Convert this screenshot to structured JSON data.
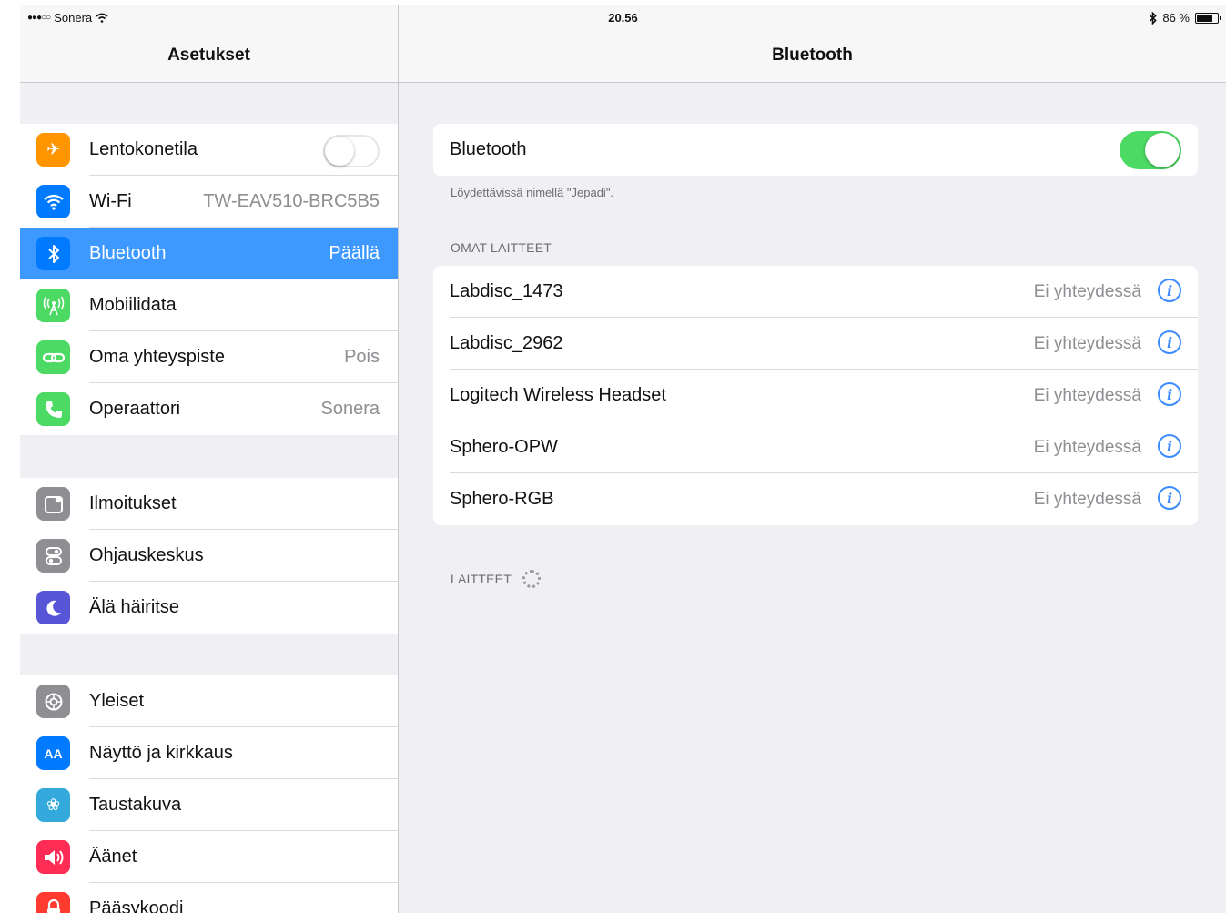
{
  "status_bar": {
    "carrier": "Sonera",
    "time": "20.56",
    "battery": "86 %",
    "battery_level": 0.86
  },
  "master": {
    "title": "Asetukset",
    "group1": [
      {
        "label": "Lentokonetila",
        "icon": "airplane-icon",
        "color": "#ff9500",
        "toggle": false
      },
      {
        "label": "Wi-Fi",
        "icon": "wifi-icon",
        "color": "#007aff",
        "value": "TW-EAV510-BRC5B5"
      },
      {
        "label": "Bluetooth",
        "icon": "bluetooth-icon",
        "color": "#007aff",
        "value": "Päällä",
        "selected": true
      },
      {
        "label": "Mobiilidata",
        "icon": "antenna-icon",
        "color": "#4cd964"
      },
      {
        "label": "Oma yhteyspiste",
        "icon": "link-icon",
        "color": "#4cd964",
        "value": "Pois"
      },
      {
        "label": "Operaattori",
        "icon": "phone-icon",
        "color": "#4cd964",
        "value": "Sonera"
      }
    ],
    "group2": [
      {
        "label": "Ilmoitukset",
        "icon": "notifications-icon",
        "color": "#8e8e93"
      },
      {
        "label": "Ohjauskeskus",
        "icon": "control-center-icon",
        "color": "#8e8e93"
      },
      {
        "label": "Älä häiritse",
        "icon": "moon-icon",
        "color": "#5856d6"
      }
    ],
    "group3": [
      {
        "label": "Yleiset",
        "icon": "gear-icon",
        "color": "#8e8e93"
      },
      {
        "label": "Näyttö ja kirkkaus",
        "icon": "text-size-icon",
        "color": "#007aff"
      },
      {
        "label": "Taustakuva",
        "icon": "flower-icon",
        "color": "#34aadc"
      },
      {
        "label": "Äänet",
        "icon": "speaker-icon",
        "color": "#ff2d55"
      },
      {
        "label": "Pääsykoodi",
        "icon": "lock-icon",
        "color": "#ff3b30"
      }
    ]
  },
  "detail": {
    "title": "Bluetooth",
    "bluetooth_label": "Bluetooth",
    "bluetooth_on": true,
    "discoverable_note": "Löydettävissä nimellä \"Jepadi\".",
    "my_devices_header": "OMAT LAITTEET",
    "devices": [
      {
        "name": "Labdisc_1473",
        "status": "Ei yhteydessä"
      },
      {
        "name": "Labdisc_2962",
        "status": "Ei yhteydessä"
      },
      {
        "name": "Logitech Wireless Headset",
        "status": "Ei yhteydessä"
      },
      {
        "name": "Sphero-OPW",
        "status": "Ei yhteydessä"
      },
      {
        "name": "Sphero-RGB",
        "status": "Ei yhteydessä"
      }
    ],
    "devices_header": "LAITTEET"
  }
}
